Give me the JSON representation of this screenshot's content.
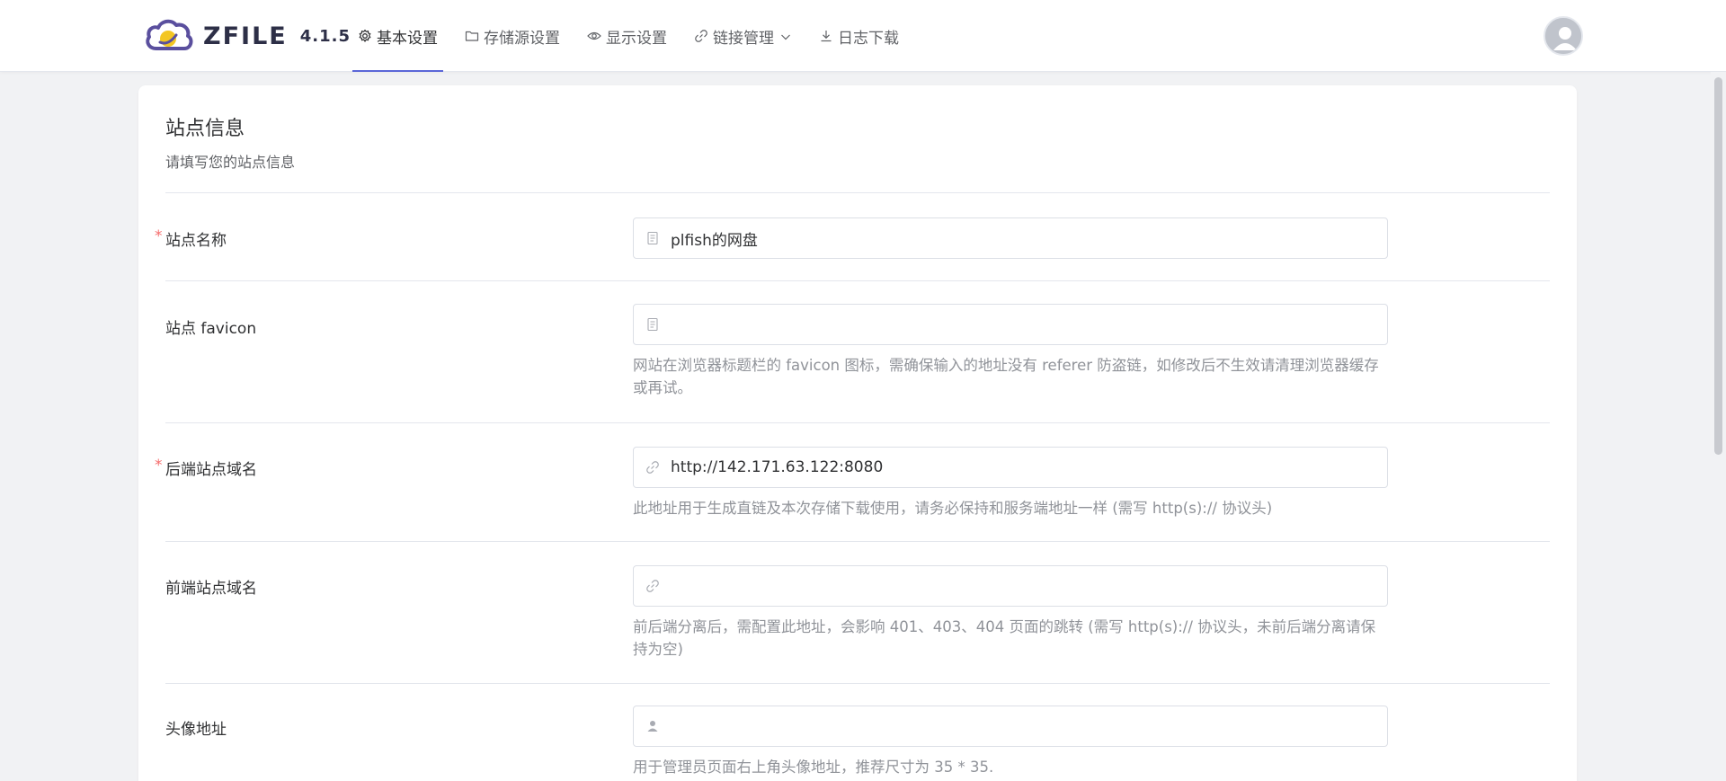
{
  "header": {
    "logo_text": "ZFILE",
    "version": "4.1.5",
    "nav": [
      {
        "label": "基本设置",
        "icon": "gear-icon",
        "active": true
      },
      {
        "label": "存储源设置",
        "icon": "folder-icon",
        "active": false
      },
      {
        "label": "显示设置",
        "icon": "eye-icon",
        "active": false
      },
      {
        "label": "链接管理",
        "icon": "link-icon",
        "active": false,
        "dropdown": true
      },
      {
        "label": "日志下载",
        "icon": "download-icon",
        "active": false
      }
    ],
    "avatar_icon": "user-avatar-icon"
  },
  "section": {
    "title": "站点信息",
    "subtitle": "请填写您的站点信息"
  },
  "fields": [
    {
      "label": "站点名称",
      "required": true,
      "value": "plfish的网盘",
      "icon": "document-icon",
      "help": ""
    },
    {
      "label": "站点 favicon",
      "required": false,
      "value": "",
      "icon": "document-icon",
      "help": "网站在浏览器标题栏的 favicon 图标，需确保输入的地址没有 referer 防盗链，如修改后不生效请清理浏览器缓存或再试。"
    },
    {
      "label": "后端站点域名",
      "required": true,
      "value": "http://142.171.63.122:8080",
      "icon": "link-icon",
      "help": "此地址用于生成直链及本次存储下载使用，请务必保持和服务端地址一样 (需写 http(s):// 协议头)"
    },
    {
      "label": "前端站点域名",
      "required": false,
      "value": "",
      "icon": "link-icon",
      "help": "前后端分离后，需配置此地址，会影响 401、403、404 页面的跳转 (需写 http(s):// 协议头，未前后端分离请保持为空)"
    },
    {
      "label": "头像地址",
      "required": false,
      "value": "",
      "icon": "user-icon",
      "help": "用于管理员页面右上角头像地址，推荐尺寸为 35 * 35."
    }
  ],
  "required_mark": "*",
  "colors": {
    "accent": "#5b67d8",
    "required": "#f56c6c",
    "background": "#f1f2f4"
  }
}
